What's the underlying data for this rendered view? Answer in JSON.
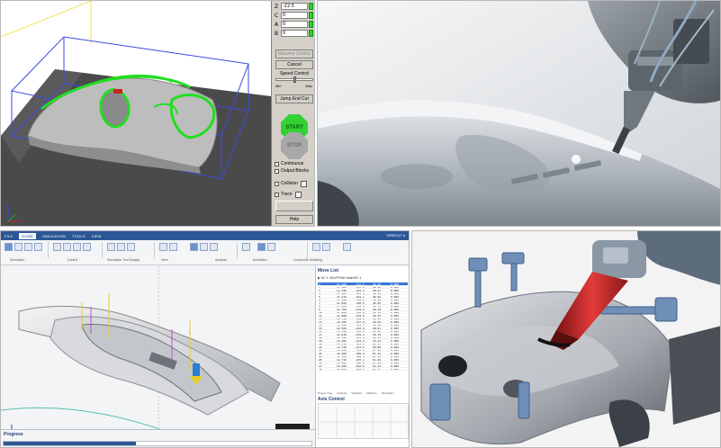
{
  "simulator": {
    "axes": [
      {
        "label": "Z",
        "value": "-22.5"
      },
      {
        "label": "C",
        "value": "0"
      },
      {
        "label": "A",
        "value": "0"
      },
      {
        "label": "B",
        "value": "0"
      }
    ],
    "buttons": {
      "disabled_top": "Resume Control",
      "cancel": "Cancel",
      "jump": "Jump End Cut",
      "help": "Help"
    },
    "speed_control": {
      "label": "Speed Control",
      "min": "Min",
      "max": "Max"
    },
    "start": "START",
    "stop": "STOP",
    "checks": {
      "continuous": "Continuous",
      "output_blocks": "Output Blocks",
      "collision": "Collision",
      "trace": "Trace"
    }
  },
  "cam": {
    "tabs": [
      "FILE",
      "HOME",
      "SIMULATION",
      "TOOLS",
      "VIEW"
    ],
    "active_tab": "HOME",
    "window_title": "VERICUT 8",
    "ribbon_groups": [
      "Simulation",
      "Control",
      "Simulation Tool Display",
      "View",
      "Analysis",
      "Animation",
      "Composite Modeling"
    ],
    "side_title": "Move List",
    "side_subtitle": "▶ NC 1: 6DoF/Filter Main/NC 1",
    "side_tabs": [
      "Project Tree",
      "Analysis",
      "Statistics",
      "Machine",
      "Simulation"
    ],
    "aux_title": "Axis Control",
    "progress_title": "Progress",
    "progress_fraction": 0.43,
    "move_rows": [
      [
        "1",
        "11.280",
        "-221.5",
        "48.90",
        "0.000"
      ],
      [
        "2",
        "11.290",
        "-221.5",
        "48.90",
        "0.000"
      ],
      [
        "3",
        "11.320",
        "-221.4",
        "48.91",
        "0.000"
      ],
      [
        "4",
        "11.360",
        "-221.3",
        "48.93",
        "0.000"
      ],
      [
        "5",
        "11.410",
        "-221.1",
        "48.96",
        "0.000"
      ],
      [
        "6",
        "11.480",
        "-220.9",
        "49.00",
        "0.000"
      ],
      [
        "7",
        "11.560",
        "-220.6",
        "49.05",
        "0.000"
      ],
      [
        "8",
        "11.650",
        "-220.3",
        "49.11",
        "0.000"
      ],
      [
        "9",
        "11.750",
        "-219.9",
        "49.18",
        "0.000"
      ],
      [
        "10",
        "11.860",
        "-219.5",
        "49.26",
        "0.000"
      ],
      [
        "11",
        "11.980",
        "-219.0",
        "49.35",
        "0.000"
      ],
      [
        "12",
        "12.110",
        "-218.5",
        "49.45",
        "0.000"
      ],
      [
        "13",
        "12.250",
        "-217.9",
        "49.56",
        "0.000"
      ],
      [
        "14",
        "12.400",
        "-217.3",
        "49.68",
        "0.000"
      ],
      [
        "15",
        "12.560",
        "-216.6",
        "49.81",
        "0.000"
      ],
      [
        "16",
        "12.730",
        "-215.9",
        "49.95",
        "0.000"
      ],
      [
        "17",
        "12.910",
        "-215.1",
        "50.10",
        "0.000"
      ],
      [
        "18",
        "13.100",
        "-214.3",
        "50.26",
        "0.000"
      ],
      [
        "19",
        "13.300",
        "-213.4",
        "50.43",
        "0.000"
      ],
      [
        "20",
        "13.510",
        "-212.5",
        "50.61",
        "0.000"
      ],
      [
        "21",
        "13.730",
        "-211.5",
        "50.80",
        "0.000"
      ],
      [
        "22",
        "13.960",
        "-210.5",
        "51.00",
        "0.000"
      ],
      [
        "23",
        "14.200",
        "-209.4",
        "51.21",
        "0.000"
      ],
      [
        "24",
        "14.450",
        "-208.3",
        "51.43",
        "0.000"
      ],
      [
        "25",
        "14.710",
        "-207.1",
        "51.66",
        "0.000"
      ],
      [
        "26",
        "14.980",
        "-205.9",
        "51.90",
        "0.000"
      ],
      [
        "27",
        "15.260",
        "-204.6",
        "52.15",
        "0.000"
      ],
      [
        "28",
        "15.550",
        "-203.3",
        "52.41",
        "0.000"
      ]
    ]
  }
}
